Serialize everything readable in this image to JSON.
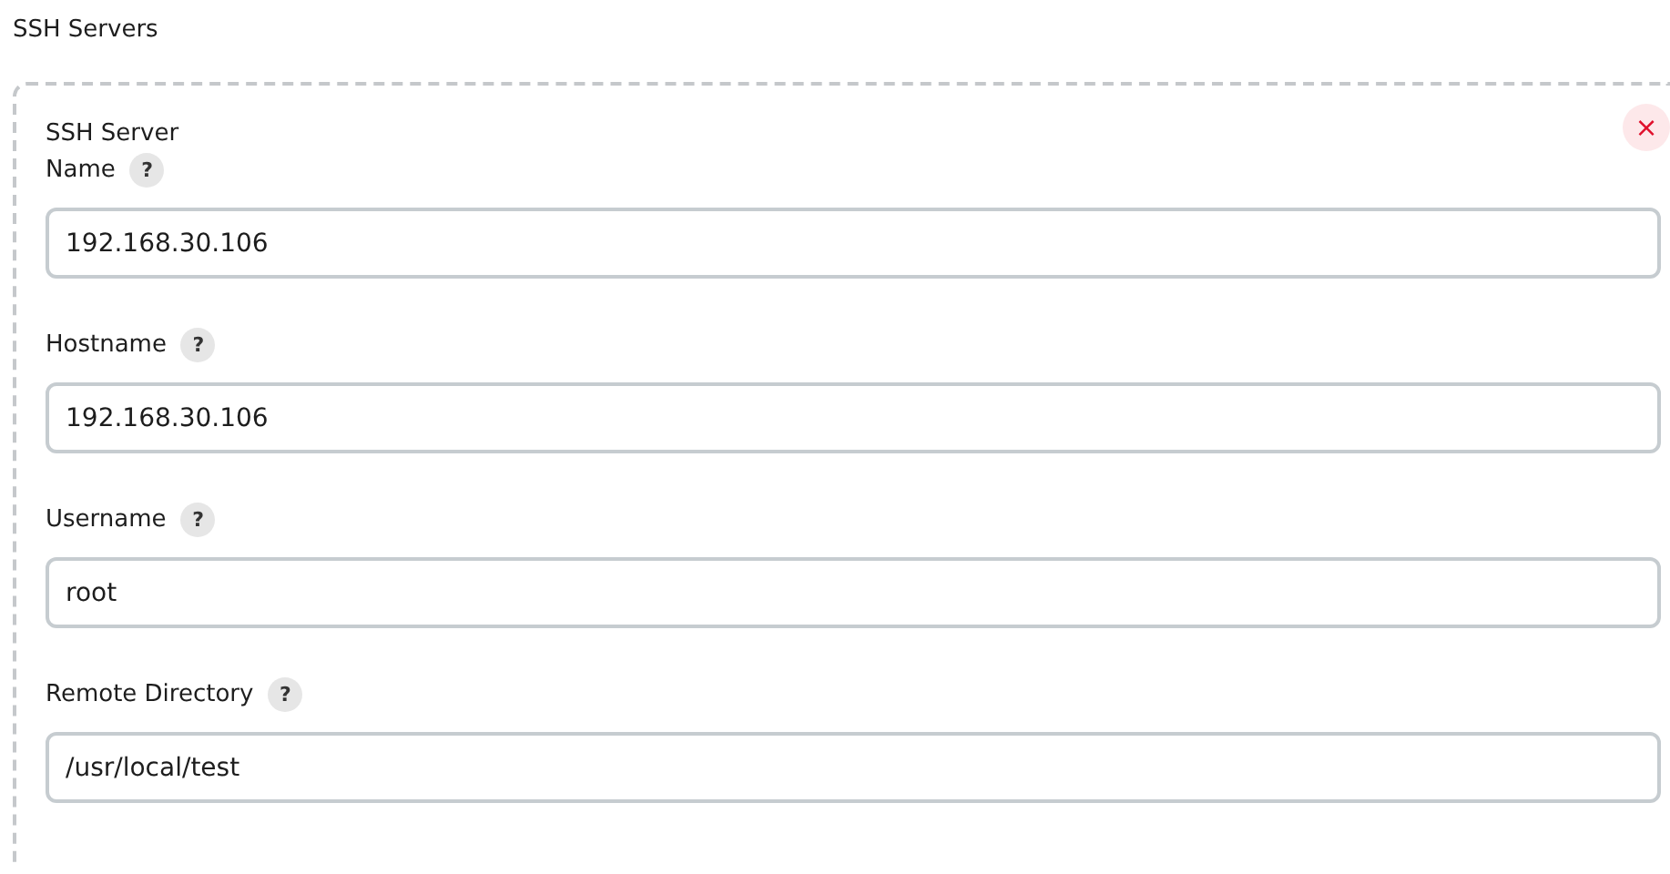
{
  "section_title": "SSH Servers",
  "server": {
    "title": "SSH Server",
    "delete_icon": "×",
    "fields": [
      {
        "label": "Name",
        "help": "?",
        "value": "192.168.30.106"
      },
      {
        "label": "Hostname",
        "help": "?",
        "value": "192.168.30.106"
      },
      {
        "label": "Username",
        "help": "?",
        "value": "root"
      },
      {
        "label": "Remote Directory",
        "help": "?",
        "value": "/usr/local/test"
      }
    ]
  }
}
